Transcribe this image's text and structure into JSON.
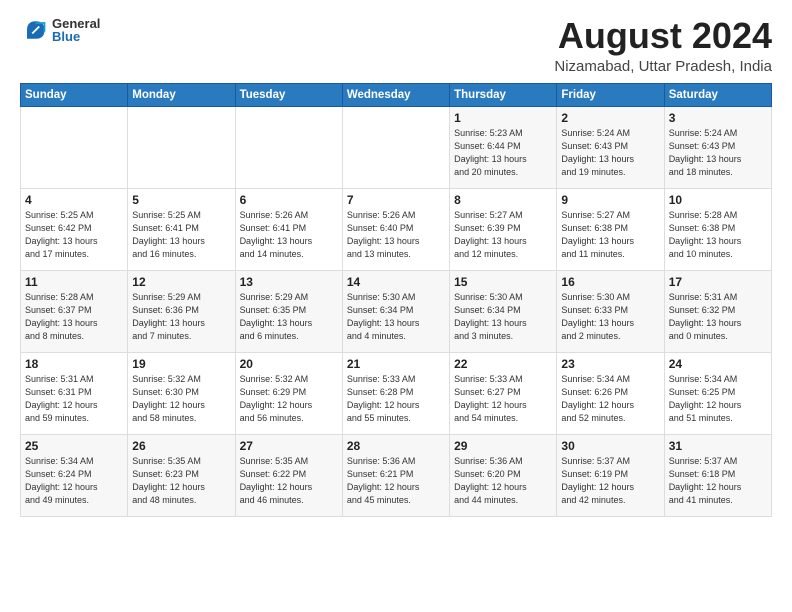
{
  "logo": {
    "general": "General",
    "blue": "Blue"
  },
  "title": "August 2024",
  "subtitle": "Nizamabad, Uttar Pradesh, India",
  "days_of_week": [
    "Sunday",
    "Monday",
    "Tuesday",
    "Wednesday",
    "Thursday",
    "Friday",
    "Saturday"
  ],
  "weeks": [
    [
      {
        "day": "",
        "info": ""
      },
      {
        "day": "",
        "info": ""
      },
      {
        "day": "",
        "info": ""
      },
      {
        "day": "",
        "info": ""
      },
      {
        "day": "1",
        "info": "Sunrise: 5:23 AM\nSunset: 6:44 PM\nDaylight: 13 hours\nand 20 minutes."
      },
      {
        "day": "2",
        "info": "Sunrise: 5:24 AM\nSunset: 6:43 PM\nDaylight: 13 hours\nand 19 minutes."
      },
      {
        "day": "3",
        "info": "Sunrise: 5:24 AM\nSunset: 6:43 PM\nDaylight: 13 hours\nand 18 minutes."
      }
    ],
    [
      {
        "day": "4",
        "info": "Sunrise: 5:25 AM\nSunset: 6:42 PM\nDaylight: 13 hours\nand 17 minutes."
      },
      {
        "day": "5",
        "info": "Sunrise: 5:25 AM\nSunset: 6:41 PM\nDaylight: 13 hours\nand 16 minutes."
      },
      {
        "day": "6",
        "info": "Sunrise: 5:26 AM\nSunset: 6:41 PM\nDaylight: 13 hours\nand 14 minutes."
      },
      {
        "day": "7",
        "info": "Sunrise: 5:26 AM\nSunset: 6:40 PM\nDaylight: 13 hours\nand 13 minutes."
      },
      {
        "day": "8",
        "info": "Sunrise: 5:27 AM\nSunset: 6:39 PM\nDaylight: 13 hours\nand 12 minutes."
      },
      {
        "day": "9",
        "info": "Sunrise: 5:27 AM\nSunset: 6:38 PM\nDaylight: 13 hours\nand 11 minutes."
      },
      {
        "day": "10",
        "info": "Sunrise: 5:28 AM\nSunset: 6:38 PM\nDaylight: 13 hours\nand 10 minutes."
      }
    ],
    [
      {
        "day": "11",
        "info": "Sunrise: 5:28 AM\nSunset: 6:37 PM\nDaylight: 13 hours\nand 8 minutes."
      },
      {
        "day": "12",
        "info": "Sunrise: 5:29 AM\nSunset: 6:36 PM\nDaylight: 13 hours\nand 7 minutes."
      },
      {
        "day": "13",
        "info": "Sunrise: 5:29 AM\nSunset: 6:35 PM\nDaylight: 13 hours\nand 6 minutes."
      },
      {
        "day": "14",
        "info": "Sunrise: 5:30 AM\nSunset: 6:34 PM\nDaylight: 13 hours\nand 4 minutes."
      },
      {
        "day": "15",
        "info": "Sunrise: 5:30 AM\nSunset: 6:34 PM\nDaylight: 13 hours\nand 3 minutes."
      },
      {
        "day": "16",
        "info": "Sunrise: 5:30 AM\nSunset: 6:33 PM\nDaylight: 13 hours\nand 2 minutes."
      },
      {
        "day": "17",
        "info": "Sunrise: 5:31 AM\nSunset: 6:32 PM\nDaylight: 13 hours\nand 0 minutes."
      }
    ],
    [
      {
        "day": "18",
        "info": "Sunrise: 5:31 AM\nSunset: 6:31 PM\nDaylight: 12 hours\nand 59 minutes."
      },
      {
        "day": "19",
        "info": "Sunrise: 5:32 AM\nSunset: 6:30 PM\nDaylight: 12 hours\nand 58 minutes."
      },
      {
        "day": "20",
        "info": "Sunrise: 5:32 AM\nSunset: 6:29 PM\nDaylight: 12 hours\nand 56 minutes."
      },
      {
        "day": "21",
        "info": "Sunrise: 5:33 AM\nSunset: 6:28 PM\nDaylight: 12 hours\nand 55 minutes."
      },
      {
        "day": "22",
        "info": "Sunrise: 5:33 AM\nSunset: 6:27 PM\nDaylight: 12 hours\nand 54 minutes."
      },
      {
        "day": "23",
        "info": "Sunrise: 5:34 AM\nSunset: 6:26 PM\nDaylight: 12 hours\nand 52 minutes."
      },
      {
        "day": "24",
        "info": "Sunrise: 5:34 AM\nSunset: 6:25 PM\nDaylight: 12 hours\nand 51 minutes."
      }
    ],
    [
      {
        "day": "25",
        "info": "Sunrise: 5:34 AM\nSunset: 6:24 PM\nDaylight: 12 hours\nand 49 minutes."
      },
      {
        "day": "26",
        "info": "Sunrise: 5:35 AM\nSunset: 6:23 PM\nDaylight: 12 hours\nand 48 minutes."
      },
      {
        "day": "27",
        "info": "Sunrise: 5:35 AM\nSunset: 6:22 PM\nDaylight: 12 hours\nand 46 minutes."
      },
      {
        "day": "28",
        "info": "Sunrise: 5:36 AM\nSunset: 6:21 PM\nDaylight: 12 hours\nand 45 minutes."
      },
      {
        "day": "29",
        "info": "Sunrise: 5:36 AM\nSunset: 6:20 PM\nDaylight: 12 hours\nand 44 minutes."
      },
      {
        "day": "30",
        "info": "Sunrise: 5:37 AM\nSunset: 6:19 PM\nDaylight: 12 hours\nand 42 minutes."
      },
      {
        "day": "31",
        "info": "Sunrise: 5:37 AM\nSunset: 6:18 PM\nDaylight: 12 hours\nand 41 minutes."
      }
    ]
  ]
}
